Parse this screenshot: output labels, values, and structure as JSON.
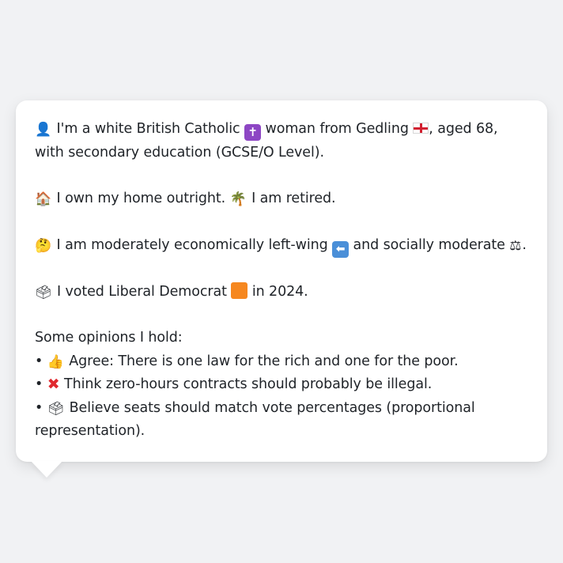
{
  "profile": {
    "line1_prefix_icon": "person-silhouette-icon",
    "line1_text_a": "I'm a white British Catholic",
    "line1_icon_cross": "latin-cross-icon",
    "line1_text_b": "woman from Gedling",
    "line1_icon_flag": "england-flag-icon",
    "line1_text_c": ", aged 68, with secondary education (GCSE/O Level).",
    "home_icon": "house-icon",
    "home_text": "I own my home outright.",
    "retired_icon": "palm-tree-icon",
    "retired_text": "I am retired.",
    "politics_icon": "thinking-face-icon",
    "politics_text_a": "I am moderately economically left-wing",
    "politics_icon_left": "left-arrow-icon",
    "politics_text_b": "and socially moderate",
    "politics_icon_scales": "balance-scale-icon",
    "politics_text_c": ".",
    "vote_icon": "ballot-box-icon",
    "vote_text_a": "I voted Liberal Democrat",
    "vote_icon_party": "orange-square-icon",
    "vote_text_b": "in 2024.",
    "opinions_heading": "Some opinions I hold:",
    "opinions": [
      {
        "bullet": "•",
        "icon": "thumbs-up-icon",
        "text": "Agree: There is one law for the rich and one for the poor."
      },
      {
        "bullet": "•",
        "icon": "cross-mark-icon",
        "text": "Think zero-hours contracts should probably be illegal."
      },
      {
        "bullet": "•",
        "icon": "ballot-box-icon",
        "text": "Believe seats should match vote percentages (proportional representation)."
      }
    ]
  },
  "colors": {
    "background": "#f1f2f4",
    "card": "#ffffff",
    "text": "#1f2328",
    "party_orange": "#f6871f",
    "cross_purple": "#8d46c4",
    "arrow_blue": "#4a8fd8",
    "cross_red": "#e0282e"
  }
}
